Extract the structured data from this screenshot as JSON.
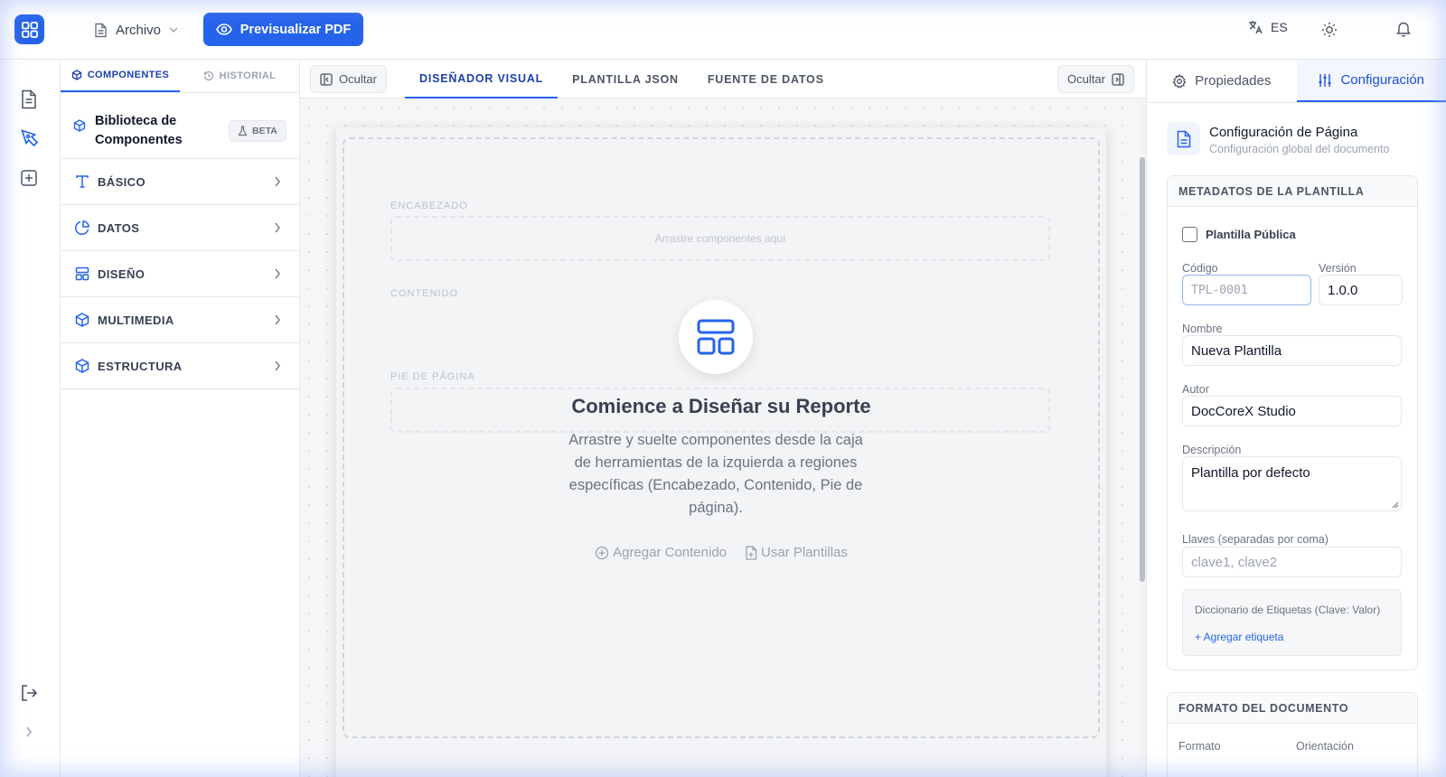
{
  "header": {
    "file_menu_label": "Archivo",
    "preview_button_label": "Previsualizar PDF",
    "language_code": "ES"
  },
  "components_panel": {
    "tabs": [
      {
        "label": "COMPONENTES",
        "active": true
      },
      {
        "label": "HISTORIAL",
        "active": false
      }
    ],
    "library_title": "Biblioteca de Componentes",
    "beta_badge": "BETA",
    "categories": [
      {
        "label": "BÁSICO",
        "icon": "type-icon"
      },
      {
        "label": "DATOS",
        "icon": "pie-chart-icon"
      },
      {
        "label": "DISEÑO",
        "icon": "layout-icon"
      },
      {
        "label": "MULTIMEDIA",
        "icon": "box-icon"
      },
      {
        "label": "ESTRUCTURA",
        "icon": "box-icon"
      }
    ]
  },
  "designer": {
    "hide_left_label": "Ocultar",
    "hide_right_label": "Ocultar",
    "tabs": [
      {
        "label": "DISEÑADOR VISUAL",
        "active": true
      },
      {
        "label": "PLANTILLA JSON",
        "active": false
      },
      {
        "label": "FUENTE DE DATOS",
        "active": false
      }
    ],
    "regions": {
      "header": "ENCABEZADO",
      "content": "CONTENIDO",
      "footer": "PIE DE PÁGINA",
      "drop_placeholder": "Arrastre componentes aquí"
    },
    "empty_state": {
      "title": "Comience a Diseñar su Reporte",
      "description": "Arrastre y suelte componentes desde la caja de herramientas de la izquierda a regiones específicas (Encabezado, Contenido, Pie de página).",
      "add_content_label": "Agregar Contenido",
      "use_templates_label": "Usar Plantillas"
    }
  },
  "properties_panel": {
    "tabs": [
      {
        "label": "Propiedades",
        "active": false
      },
      {
        "label": "Configuración",
        "active": true
      }
    ],
    "config_title": "Configuración de Página",
    "config_subtitle": "Configuración global del documento",
    "metadata_section": {
      "title": "METADATOS DE LA PLANTILLA",
      "public_label": "Plantilla Pública",
      "public_checked": false,
      "code_label": "Código",
      "code_placeholder": "TPL-0001",
      "version_label": "Versión",
      "version_value": "1.0.0",
      "name_label": "Nombre",
      "name_value": "Nueva Plantilla",
      "author_label": "Autor",
      "author_value": "DocCoreX Studio",
      "description_label": "Descripción",
      "description_value": "Plantilla por defecto",
      "keys_label": "Llaves (separadas por coma)",
      "keys_placeholder": "clave1, clave2",
      "tags_title": "Diccionario de Etiquetas (Clave: Valor)",
      "add_tag_label": "+ Agregar etiqueta"
    },
    "format_section": {
      "title": "FORMATO DEL DOCUMENTO",
      "format_label": "Formato",
      "orientation_label": "Orientación"
    }
  },
  "colors": {
    "accent": "#2563eb",
    "accent_dark": "#1e40af"
  }
}
